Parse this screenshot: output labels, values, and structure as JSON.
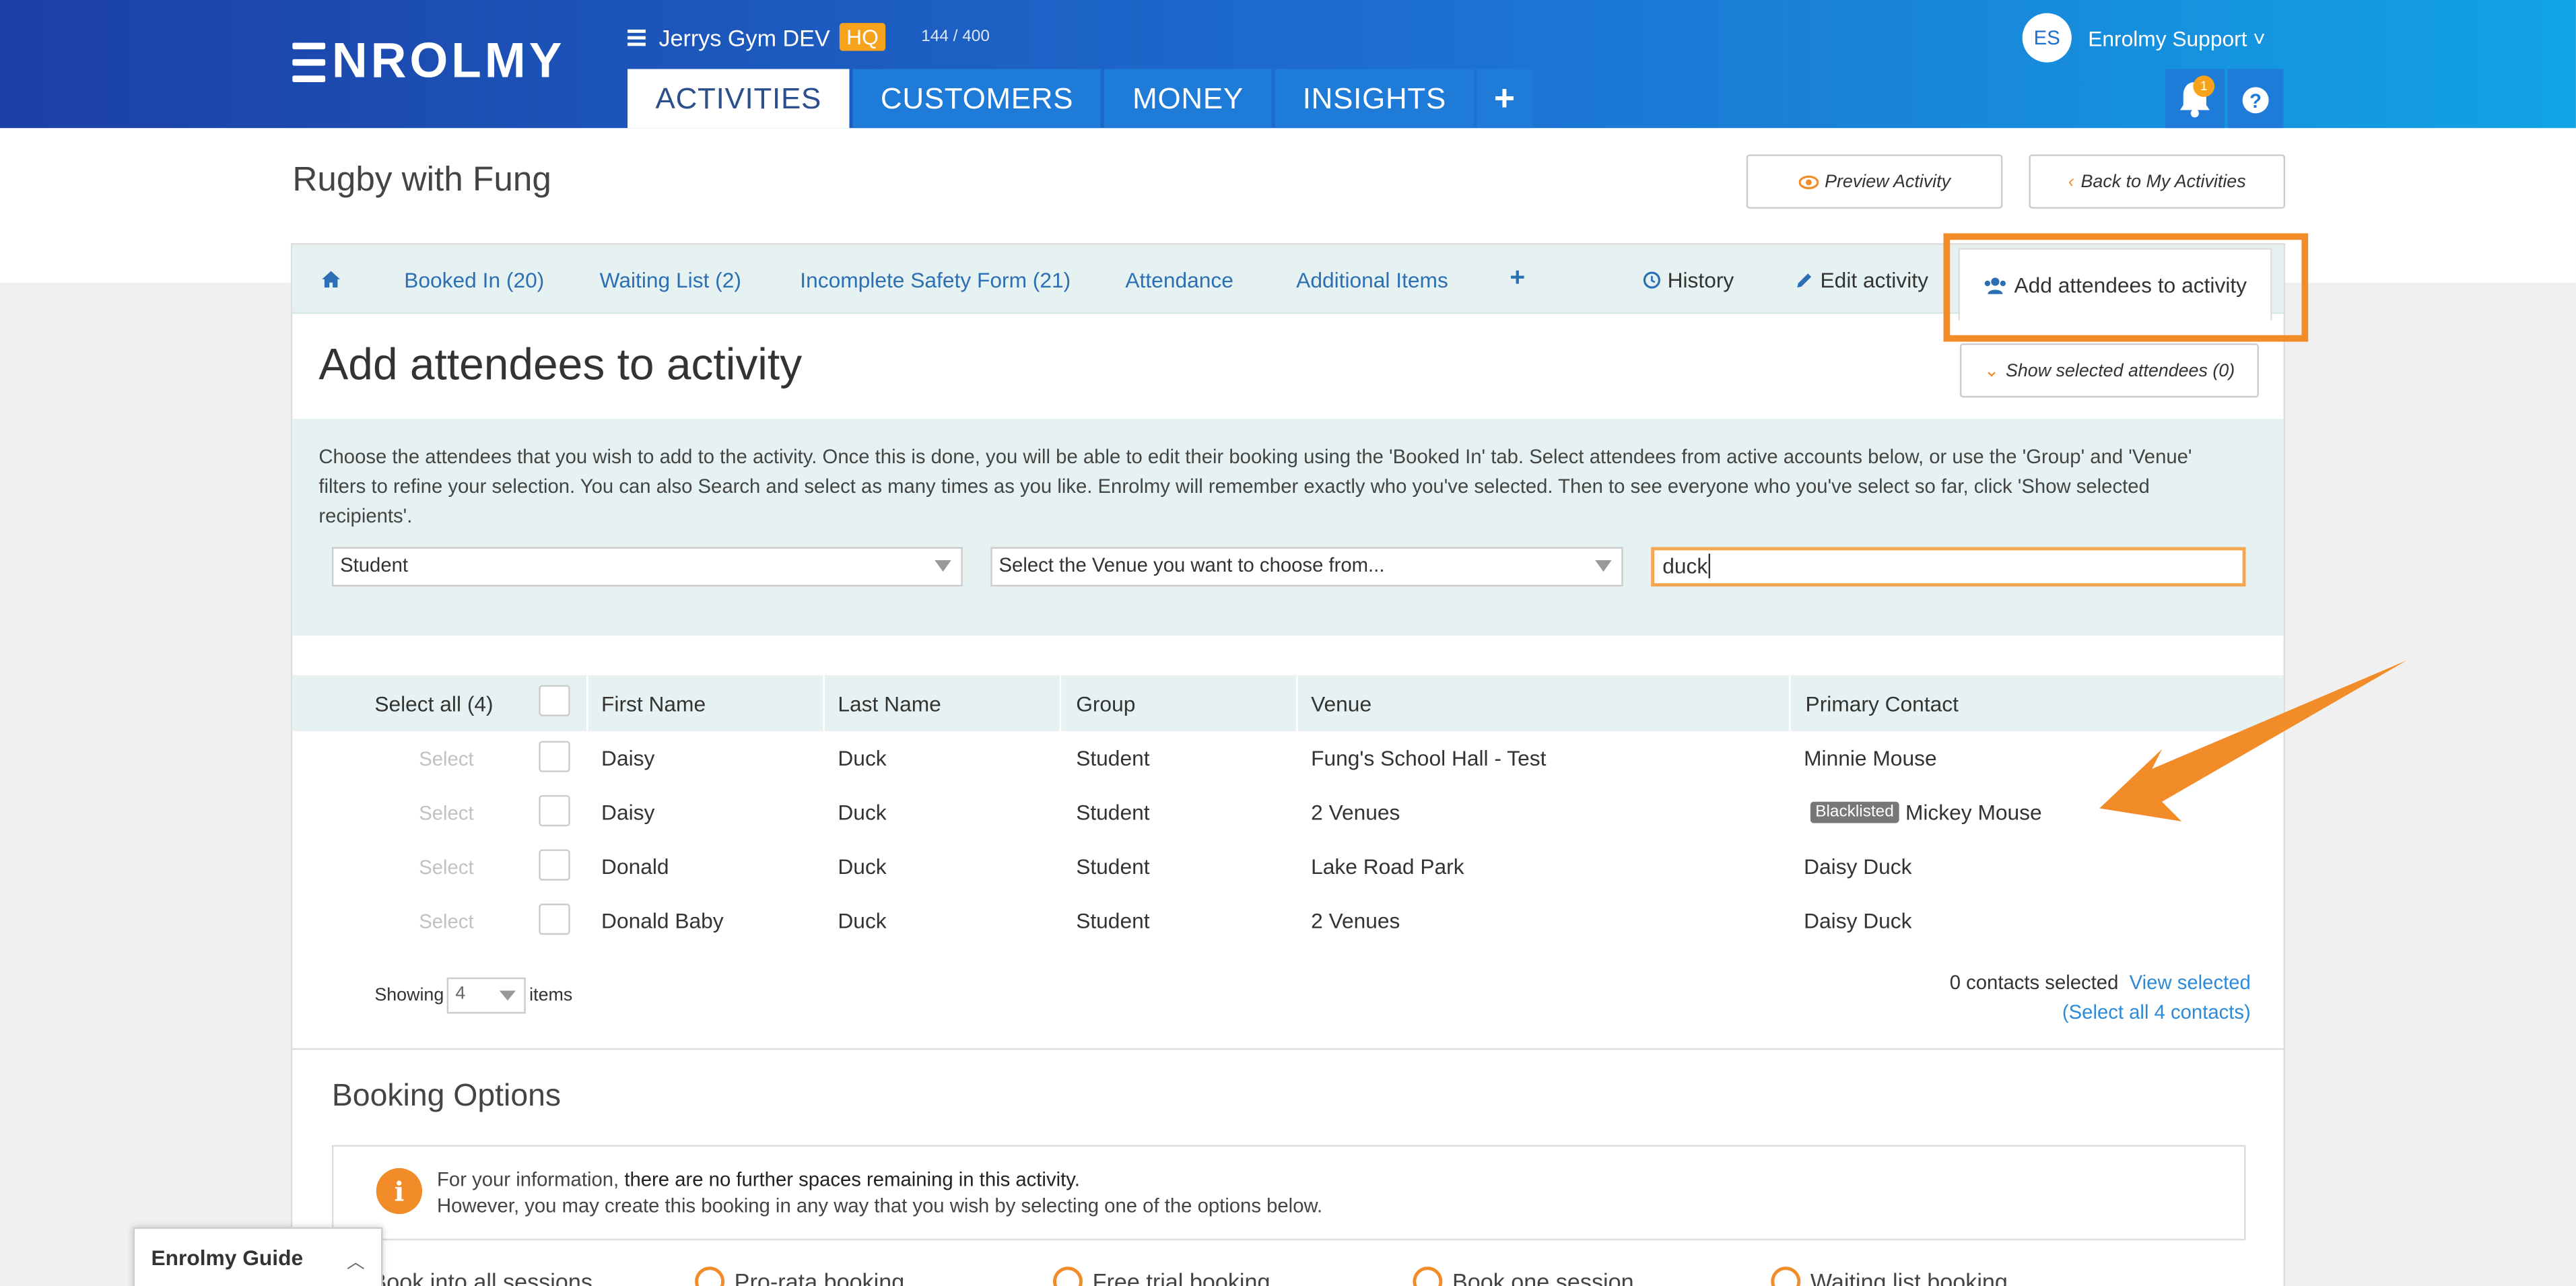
{
  "header": {
    "logo": "ENROLMY",
    "org_name": "Jerrys Gym DEV",
    "org_badge": "HQ",
    "usage": "144 / 400",
    "user_initials": "ES",
    "user_name": "Enrolmy Support ˅",
    "notification_count": "1",
    "tabs": [
      {
        "label": "ACTIVITIES"
      },
      {
        "label": "CUSTOMERS"
      },
      {
        "label": "MONEY"
      },
      {
        "label": "INSIGHTS"
      }
    ],
    "plus": "+"
  },
  "page": {
    "title": "Rugby with Fung",
    "preview_button": "Preview Activity",
    "back_button": "Back to My Activities"
  },
  "subtabs": {
    "booked_in": "Booked In (20)",
    "waiting_list": "Waiting List (2)",
    "incomplete_safety": "Incomplete Safety Form (21)",
    "attendance": "Attendance",
    "additional_items": "Additional Items",
    "plus": "+",
    "history": "History",
    "edit_activity": "Edit activity",
    "add_attendees": "Add attendees to activity"
  },
  "section": {
    "title": "Add attendees to activity",
    "show_selected": "Show selected attendees (0)",
    "description": "Choose the attendees that you wish to add to the activity. Once this is done, you will be able to edit their booking using the 'Booked In' tab. Select attendees from active accounts below, or use the 'Group' and 'Venue' filters to refine your selection. You can also Search and select as many times as you like. Enrolmy will remember exactly who you've selected. Then to see everyone who you've select so far, click 'Show selected recipients'.",
    "group_filter": "Student",
    "venue_filter": "Select the Venue you want to choose from...",
    "search_value": "duck"
  },
  "table": {
    "select_all": "Select all (4)",
    "columns": [
      "First Name",
      "Last Name",
      "Group",
      "Venue",
      "Primary Contact"
    ],
    "select_label": "Select",
    "blacklisted_label": "Blacklisted",
    "rows": [
      {
        "first": "Daisy",
        "last": "Duck",
        "group": "Student",
        "venue": "Fung's School Hall - Test",
        "contact": "Minnie Mouse",
        "blacklisted": false
      },
      {
        "first": "Daisy",
        "last": "Duck",
        "group": "Student",
        "venue": "2 Venues",
        "contact": "Mickey Mouse",
        "blacklisted": true
      },
      {
        "first": "Donald",
        "last": "Duck",
        "group": "Student",
        "venue": "Lake Road Park",
        "contact": "Daisy Duck",
        "blacklisted": false
      },
      {
        "first": "Donald Baby",
        "last": "Duck",
        "group": "Student",
        "venue": "2 Venues",
        "contact": "Daisy Duck",
        "blacklisted": false
      }
    ],
    "showing_label": "Showing",
    "showing_value": "4",
    "items_label": "items",
    "contacts_selected": "0 contacts selected",
    "view_selected": "View selected",
    "select_all_contacts": "(Select all 4 contacts)"
  },
  "booking": {
    "title": "Booking Options",
    "notice_prefix": "For your information,",
    "notice_bold": "there are no further spaces remaining in this activity.",
    "notice_line2": "However, you may create this booking in any way that you wish by selecting one of the options below.",
    "options": [
      "Book into all sessions",
      "Pro-rata booking",
      "Free trial booking",
      "Book one session",
      "Waiting list booking"
    ]
  },
  "guide": {
    "label": "Enrolmy Guide"
  },
  "colors": {
    "brand_blue": "#1d6fd1",
    "accent_orange": "#f28c28",
    "teal_bg": "#e6f2f2",
    "link_blue": "#2d8ad8"
  }
}
